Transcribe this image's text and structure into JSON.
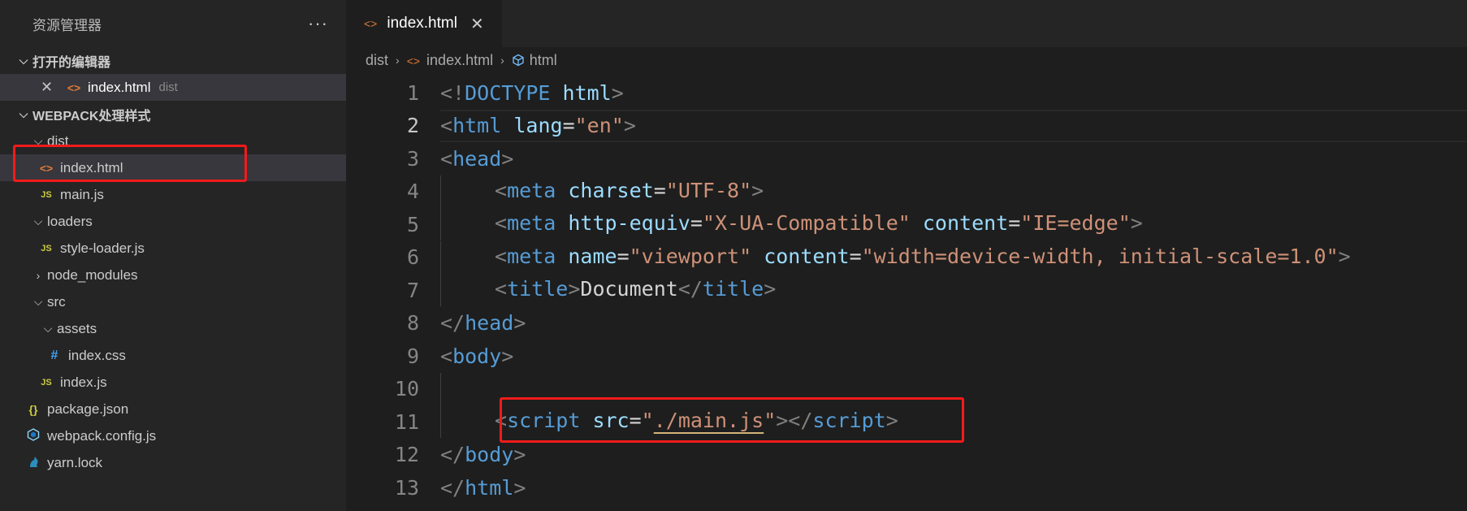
{
  "sidebar": {
    "title": "资源管理器",
    "more_label": "···",
    "open_editors": {
      "label": "打开的编辑器",
      "items": [
        {
          "name": "index.html",
          "folder": "dist",
          "icon": "html-file-icon"
        }
      ]
    },
    "project": {
      "label": "WEBPACK处理样式",
      "tree": {
        "dist": "dist",
        "dist_index": "index.html",
        "dist_main": "main.js",
        "loaders": "loaders",
        "style_loader": "style-loader.js",
        "node_modules": "node_modules",
        "src": "src",
        "assets": "assets",
        "index_css": "index.css",
        "index_js": "index.js",
        "package_json": "package.json",
        "webpack_config": "webpack.config.js",
        "yarn_lock": "yarn.lock"
      }
    },
    "icons": {
      "html": "<>",
      "js": "JS",
      "css": "#",
      "json": "{}"
    }
  },
  "tab": {
    "label": "index.html",
    "close": "✕"
  },
  "breadcrumb": {
    "folder": "dist",
    "file": "index.html",
    "symbol": "html"
  },
  "code_lines": [
    {
      "n": "1",
      "tokens": [
        [
          "punct",
          "<!"
        ],
        [
          "tag",
          "DOCTYPE"
        ],
        [
          "text",
          " "
        ],
        [
          "attr",
          "html"
        ],
        [
          "punct",
          ">"
        ]
      ]
    },
    {
      "n": "2",
      "tokens": [
        [
          "punct",
          "<"
        ],
        [
          "tag",
          "html"
        ],
        [
          "text",
          " "
        ],
        [
          "attr",
          "lang"
        ],
        [
          "text",
          "="
        ],
        [
          "str",
          "\"en\""
        ],
        [
          "punct",
          ">"
        ]
      ]
    },
    {
      "n": "3",
      "tokens": [
        [
          "punct",
          "<"
        ],
        [
          "tag",
          "head"
        ],
        [
          "punct",
          ">"
        ]
      ]
    },
    {
      "n": "4",
      "tokens": [
        [
          "punct",
          "<"
        ],
        [
          "tag",
          "meta"
        ],
        [
          "text",
          " "
        ],
        [
          "attr",
          "charset"
        ],
        [
          "text",
          "="
        ],
        [
          "str",
          "\"UTF-8\""
        ],
        [
          "punct",
          ">"
        ]
      ]
    },
    {
      "n": "5",
      "tokens": [
        [
          "punct",
          "<"
        ],
        [
          "tag",
          "meta"
        ],
        [
          "text",
          " "
        ],
        [
          "attr",
          "http-equiv"
        ],
        [
          "text",
          "="
        ],
        [
          "str",
          "\"X-UA-Compatible\""
        ],
        [
          "text",
          " "
        ],
        [
          "attr",
          "content"
        ],
        [
          "text",
          "="
        ],
        [
          "str",
          "\"IE=edge\""
        ],
        [
          "punct",
          ">"
        ]
      ]
    },
    {
      "n": "6",
      "tokens": [
        [
          "punct",
          "<"
        ],
        [
          "tag",
          "meta"
        ],
        [
          "text",
          " "
        ],
        [
          "attr",
          "name"
        ],
        [
          "text",
          "="
        ],
        [
          "str",
          "\"viewport\""
        ],
        [
          "text",
          " "
        ],
        [
          "attr",
          "content"
        ],
        [
          "text",
          "="
        ],
        [
          "str",
          "\"width=device-width, initial-scale=1.0\""
        ],
        [
          "punct",
          ">"
        ]
      ]
    },
    {
      "n": "7",
      "tokens": [
        [
          "punct",
          "<"
        ],
        [
          "tag",
          "title"
        ],
        [
          "punct",
          ">"
        ],
        [
          "text",
          "Document"
        ],
        [
          "punct",
          "</"
        ],
        [
          "tag",
          "title"
        ],
        [
          "punct",
          ">"
        ]
      ]
    },
    {
      "n": "8",
      "tokens": [
        [
          "punct",
          "</"
        ],
        [
          "tag",
          "head"
        ],
        [
          "punct",
          ">"
        ]
      ]
    },
    {
      "n": "9",
      "tokens": [
        [
          "punct",
          "<"
        ],
        [
          "tag",
          "body"
        ],
        [
          "punct",
          ">"
        ]
      ]
    },
    {
      "n": "10",
      "tokens": []
    },
    {
      "n": "11",
      "tokens": [
        [
          "punct",
          "<"
        ],
        [
          "tag",
          "script"
        ],
        [
          "text",
          " "
        ],
        [
          "attr",
          "src"
        ],
        [
          "text",
          "="
        ],
        [
          "str",
          "\""
        ],
        [
          "strlink",
          "./main.js"
        ],
        [
          "str",
          "\""
        ],
        [
          "punct",
          "></"
        ],
        [
          "tag",
          "script"
        ],
        [
          "punct",
          ">"
        ]
      ]
    },
    {
      "n": "12",
      "tokens": [
        [
          "punct",
          "</"
        ],
        [
          "tag",
          "body"
        ],
        [
          "punct",
          ">"
        ]
      ]
    },
    {
      "n": "13",
      "tokens": [
        [
          "punct",
          "</"
        ],
        [
          "tag",
          "html"
        ],
        [
          "punct",
          ">"
        ]
      ]
    }
  ],
  "current_line": "2",
  "colors": {
    "highlight_box": "#f21b1b",
    "tag": "#569cd6",
    "attr": "#9cdcfe",
    "string": "#ce9178"
  }
}
